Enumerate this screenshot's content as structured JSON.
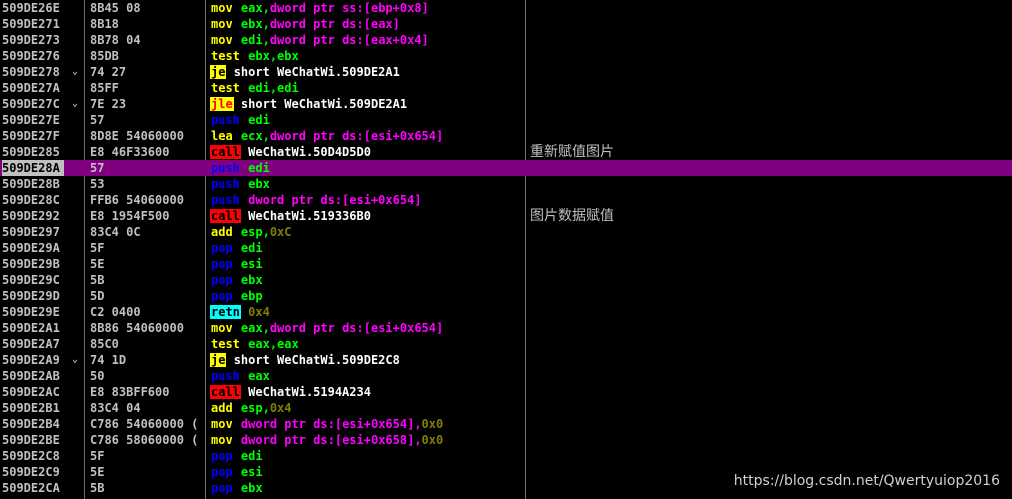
{
  "colors": {
    "background": "#000000",
    "address_text": "#c0c0c0",
    "selected_row": "#800080",
    "mnemonic_mov": "#ffff00",
    "mnemonic_push_pop": "#0000ff",
    "call_bg": "#ff0000",
    "jcc_bg": "#ffff00",
    "retn_bg": "#00ffff",
    "register": "#00ff00",
    "memory_operand": "#ff00ff"
  },
  "rows": [
    {
      "addr": "509DE26E",
      "jmp": "",
      "hex": "8B45 08",
      "mn": "mov",
      "mk": "mov",
      "ops": [
        [
          "reg",
          "eax,"
        ],
        [
          "ptr",
          "dword ptr ss:[ebp+0x8]"
        ]
      ],
      "cmt": ""
    },
    {
      "addr": "509DE271",
      "jmp": "",
      "hex": "8B18",
      "mn": "mov",
      "mk": "mov",
      "ops": [
        [
          "reg",
          "ebx,"
        ],
        [
          "ptr",
          "dword ptr ds:[eax]"
        ]
      ],
      "cmt": ""
    },
    {
      "addr": "509DE273",
      "jmp": "",
      "hex": "8B78 04",
      "mn": "mov",
      "mk": "mov",
      "ops": [
        [
          "reg",
          "edi,"
        ],
        [
          "ptr",
          "dword ptr ds:[eax+0x4]"
        ]
      ],
      "cmt": ""
    },
    {
      "addr": "509DE276",
      "jmp": "",
      "hex": "85DB",
      "mn": "test",
      "mk": "test",
      "ops": [
        [
          "reg",
          "ebx,ebx"
        ]
      ],
      "cmt": ""
    },
    {
      "addr": "509DE278",
      "jmp": "⌄",
      "hex": "74 27",
      "mn": "je",
      "mk": "je",
      "ops": [
        [
          "sym",
          "short WeChatWi.509DE2A1"
        ]
      ],
      "cmt": ""
    },
    {
      "addr": "509DE27A",
      "jmp": "",
      "hex": "85FF",
      "mn": "test",
      "mk": "test",
      "ops": [
        [
          "reg",
          "edi,edi"
        ]
      ],
      "cmt": ""
    },
    {
      "addr": "509DE27C",
      "jmp": "⌄",
      "hex": "7E 23",
      "mn": "jle",
      "mk": "jle",
      "ops": [
        [
          "sym",
          "short WeChatWi.509DE2A1"
        ]
      ],
      "cmt": ""
    },
    {
      "addr": "509DE27E",
      "jmp": "",
      "hex": "57",
      "mn": "push",
      "mk": "push",
      "ops": [
        [
          "reg",
          "edi"
        ]
      ],
      "cmt": ""
    },
    {
      "addr": "509DE27F",
      "jmp": "",
      "hex": "8D8E 54060000",
      "mn": "lea",
      "mk": "lea",
      "ops": [
        [
          "reg",
          "ecx,"
        ],
        [
          "ptr",
          "dword ptr ds:[esi+0x654]"
        ]
      ],
      "cmt": ""
    },
    {
      "addr": "509DE285",
      "jmp": "",
      "hex": "E8 46F33600",
      "mn": "call",
      "mk": "call",
      "ops": [
        [
          "sym",
          "WeChatWi.50D4D5D0"
        ]
      ],
      "cmt": "重新赋值图片"
    },
    {
      "addr": "509DE28A",
      "jmp": "",
      "hex": "57",
      "mn": "push",
      "mk": "push",
      "ops": [
        [
          "reg",
          "edi"
        ]
      ],
      "cmt": "",
      "sel": true
    },
    {
      "addr": "509DE28B",
      "jmp": "",
      "hex": "53",
      "mn": "push",
      "mk": "push",
      "ops": [
        [
          "reg",
          "ebx"
        ]
      ],
      "cmt": ""
    },
    {
      "addr": "509DE28C",
      "jmp": "",
      "hex": "FFB6 54060000",
      "mn": "push",
      "mk": "push",
      "ops": [
        [
          "ptr",
          "dword ptr ds:[esi+0x654]"
        ]
      ],
      "cmt": ""
    },
    {
      "addr": "509DE292",
      "jmp": "",
      "hex": "E8 1954F500",
      "mn": "call",
      "mk": "call",
      "ops": [
        [
          "sym",
          "WeChatWi.519336B0"
        ]
      ],
      "cmt": "图片数据赋值"
    },
    {
      "addr": "509DE297",
      "jmp": "",
      "hex": "83C4 0C",
      "mn": "add",
      "mk": "add",
      "ops": [
        [
          "reg",
          "esp,"
        ],
        [
          "num",
          "0xC"
        ]
      ],
      "cmt": ""
    },
    {
      "addr": "509DE29A",
      "jmp": "",
      "hex": "5F",
      "mn": "pop",
      "mk": "pop",
      "ops": [
        [
          "reg",
          "edi"
        ]
      ],
      "cmt": ""
    },
    {
      "addr": "509DE29B",
      "jmp": "",
      "hex": "5E",
      "mn": "pop",
      "mk": "pop",
      "ops": [
        [
          "reg",
          "esi"
        ]
      ],
      "cmt": ""
    },
    {
      "addr": "509DE29C",
      "jmp": "",
      "hex": "5B",
      "mn": "pop",
      "mk": "pop",
      "ops": [
        [
          "reg",
          "ebx"
        ]
      ],
      "cmt": ""
    },
    {
      "addr": "509DE29D",
      "jmp": "",
      "hex": "5D",
      "mn": "pop",
      "mk": "pop",
      "ops": [
        [
          "reg",
          "ebp"
        ]
      ],
      "cmt": ""
    },
    {
      "addr": "509DE29E",
      "jmp": "",
      "hex": "C2 0400",
      "mn": "retn",
      "mk": "retn",
      "ops": [
        [
          "num",
          "0x4"
        ]
      ],
      "cmt": ""
    },
    {
      "addr": "509DE2A1",
      "jmp": "",
      "hex": "8B86 54060000",
      "mn": "mov",
      "mk": "mov",
      "ops": [
        [
          "reg",
          "eax,"
        ],
        [
          "ptr",
          "dword ptr ds:[esi+0x654]"
        ]
      ],
      "cmt": ""
    },
    {
      "addr": "509DE2A7",
      "jmp": "",
      "hex": "85C0",
      "mn": "test",
      "mk": "test",
      "ops": [
        [
          "reg",
          "eax,eax"
        ]
      ],
      "cmt": ""
    },
    {
      "addr": "509DE2A9",
      "jmp": "⌄",
      "hex": "74 1D",
      "mn": "je",
      "mk": "je",
      "ops": [
        [
          "sym",
          "short WeChatWi.509DE2C8"
        ]
      ],
      "cmt": ""
    },
    {
      "addr": "509DE2AB",
      "jmp": "",
      "hex": "50",
      "mn": "push",
      "mk": "push",
      "ops": [
        [
          "reg",
          "eax"
        ]
      ],
      "cmt": ""
    },
    {
      "addr": "509DE2AC",
      "jmp": "",
      "hex": "E8 83BFF600",
      "mn": "call",
      "mk": "call",
      "ops": [
        [
          "sym",
          "WeChatWi.5194A234"
        ]
      ],
      "cmt": ""
    },
    {
      "addr": "509DE2B1",
      "jmp": "",
      "hex": "83C4 04",
      "mn": "add",
      "mk": "add",
      "ops": [
        [
          "reg",
          "esp,"
        ],
        [
          "num",
          "0x4"
        ]
      ],
      "cmt": ""
    },
    {
      "addr": "509DE2B4",
      "jmp": "",
      "hex": "C786 54060000 (",
      "mn": "mov",
      "mk": "mov",
      "ops": [
        [
          "ptr",
          "dword ptr ds:[esi+0x654],"
        ],
        [
          "num",
          "0x0"
        ]
      ],
      "cmt": ""
    },
    {
      "addr": "509DE2BE",
      "jmp": "",
      "hex": "C786 58060000 (",
      "mn": "mov",
      "mk": "mov",
      "ops": [
        [
          "ptr",
          "dword ptr ds:[esi+0x658],"
        ],
        [
          "num",
          "0x0"
        ]
      ],
      "cmt": ""
    },
    {
      "addr": "509DE2C8",
      "jmp": "",
      "hex": "5F",
      "mn": "pop",
      "mk": "pop",
      "ops": [
        [
          "reg",
          "edi"
        ]
      ],
      "cmt": ""
    },
    {
      "addr": "509DE2C9",
      "jmp": "",
      "hex": "5E",
      "mn": "pop",
      "mk": "pop",
      "ops": [
        [
          "reg",
          "esi"
        ]
      ],
      "cmt": ""
    },
    {
      "addr": "509DE2CA",
      "jmp": "",
      "hex": "5B",
      "mn": "pop",
      "mk": "pop",
      "ops": [
        [
          "reg",
          "ebx"
        ]
      ],
      "cmt": ""
    }
  ],
  "watermark": "https://blog.csdn.net/Qwertyuiop2016"
}
